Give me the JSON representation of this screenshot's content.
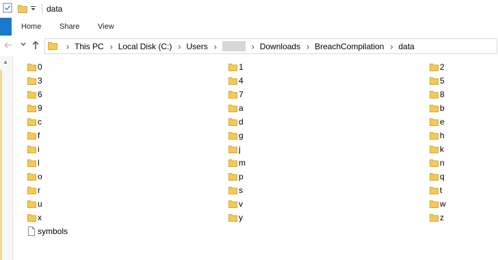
{
  "window": {
    "title": "data"
  },
  "ribbon": {
    "tabs": [
      "Home",
      "Share",
      "View"
    ]
  },
  "address": {
    "crumbs": [
      "This PC",
      "Local Disk (C:)",
      "Users",
      "",
      "Downloads",
      "BreachCompilation",
      "data"
    ]
  },
  "icons": {
    "properties": "properties-icon",
    "folder": "folder-icon",
    "file": "file-icon",
    "back": "back-arrow-icon",
    "forward": "forward-arrow-icon",
    "recent": "chevron-down-icon",
    "up": "up-arrow-icon"
  },
  "colors": {
    "folder": "#f3c95a",
    "folder_edge": "#d9a52b",
    "file_tab": "#1979ca"
  },
  "items": [
    [
      "0",
      "1",
      "2"
    ],
    [
      "3",
      "4",
      "5"
    ],
    [
      "6",
      "7",
      "8"
    ],
    [
      "9",
      "a",
      "b"
    ],
    [
      "c",
      "d",
      "e"
    ],
    [
      "f",
      "g",
      "h"
    ],
    [
      "i",
      "j",
      "k"
    ],
    [
      "l",
      "m",
      "n"
    ],
    [
      "o",
      "p",
      "q"
    ],
    [
      "r",
      "s",
      "t"
    ],
    [
      "u",
      "v",
      "w"
    ],
    [
      "x",
      "y",
      "z"
    ]
  ],
  "files": [
    "symbols"
  ]
}
